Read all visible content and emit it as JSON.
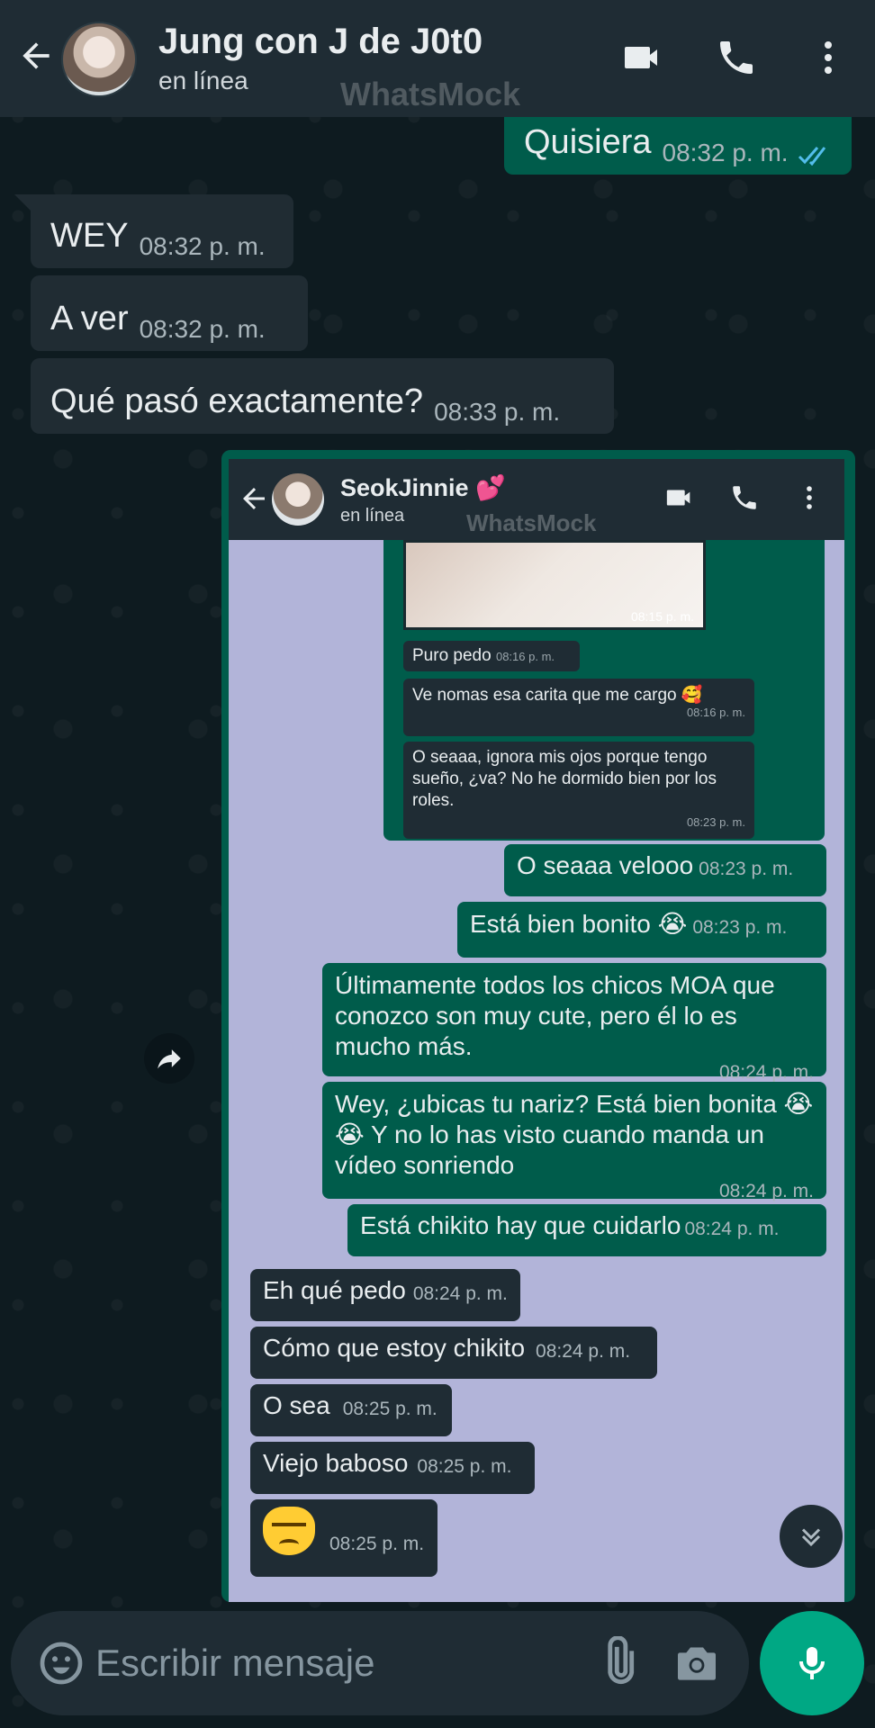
{
  "header": {
    "contact_name": "Jung con J de J0t0",
    "status": "en línea",
    "watermark": "WhatsMock"
  },
  "messages": [
    {
      "dir": "out",
      "text": "Quisiera",
      "time": "08:32 p. m.",
      "ticks": "read"
    },
    {
      "dir": "in",
      "text": "WEY",
      "time": "08:32 p. m."
    },
    {
      "dir": "in",
      "text": "A ver",
      "time": "08:32 p. m."
    },
    {
      "dir": "in",
      "text": "Qué pasó exactamente?",
      "time": "08:33 p. m."
    }
  ],
  "screenshot": {
    "header": {
      "contact_name": "SeokJinnie 💕",
      "status": "en línea",
      "watermark": "WhatsMock"
    },
    "nested": {
      "image_time": "08:15 p. m.",
      "items": [
        {
          "text": "Puro pedo",
          "time": "08:16 p. m."
        },
        {
          "text": "Ve nomas esa carita que me cargo 🥰",
          "time": "08:16 p. m."
        },
        {
          "text": "O seaaa, ignora mis ojos porque tengo sueño, ¿va? No he dormido bien por los roles.",
          "time": "08:23 p. m."
        }
      ]
    },
    "messages": [
      {
        "dir": "out",
        "text": "O seaaa velooo",
        "time": "08:23 p. m."
      },
      {
        "dir": "out",
        "text": "Está bien bonito 😭",
        "time": "08:23 p. m."
      },
      {
        "dir": "out",
        "text": "Últimamente todos los chicos MOA que conozco son muy cute, pero él lo es mucho más.",
        "time": "08:24 p. m."
      },
      {
        "dir": "out",
        "text": "Wey, ¿ubicas tu nariz? Está bien bonita 😭😭 Y no lo has visto cuando manda un vídeo sonriendo",
        "time": "08:24 p. m."
      },
      {
        "dir": "out",
        "text": "Está chikito hay que cuidarlo",
        "time": "08:24 p. m."
      },
      {
        "dir": "in",
        "text": "Eh qué pedo",
        "time": "08:24 p. m."
      },
      {
        "dir": "in",
        "text": "Cómo que estoy chikito",
        "time": "08:24 p. m."
      },
      {
        "dir": "in",
        "text": "O sea",
        "time": "08:25 p. m."
      },
      {
        "dir": "in",
        "text": "Viejo baboso",
        "time": "08:25 p. m."
      },
      {
        "dir": "in",
        "text": "",
        "emoji": "angry-cat-face",
        "time": "08:25 p. m."
      }
    ]
  },
  "input": {
    "placeholder": "Escribir mensaje"
  },
  "colors": {
    "header_bg": "#1f2c34",
    "incoming_bubble": "#202c33",
    "outgoing_bubble": "#005c4b",
    "accent": "#00a884",
    "read_ticks": "#53bdeb",
    "screenshot_bg": "#b2b4d9"
  },
  "icons": [
    "back-arrow-icon",
    "video-call-icon",
    "phone-icon",
    "more-vert-icon",
    "forward-icon",
    "chevron-double-down-icon",
    "emoji-icon",
    "attach-icon",
    "camera-icon",
    "mic-icon"
  ]
}
